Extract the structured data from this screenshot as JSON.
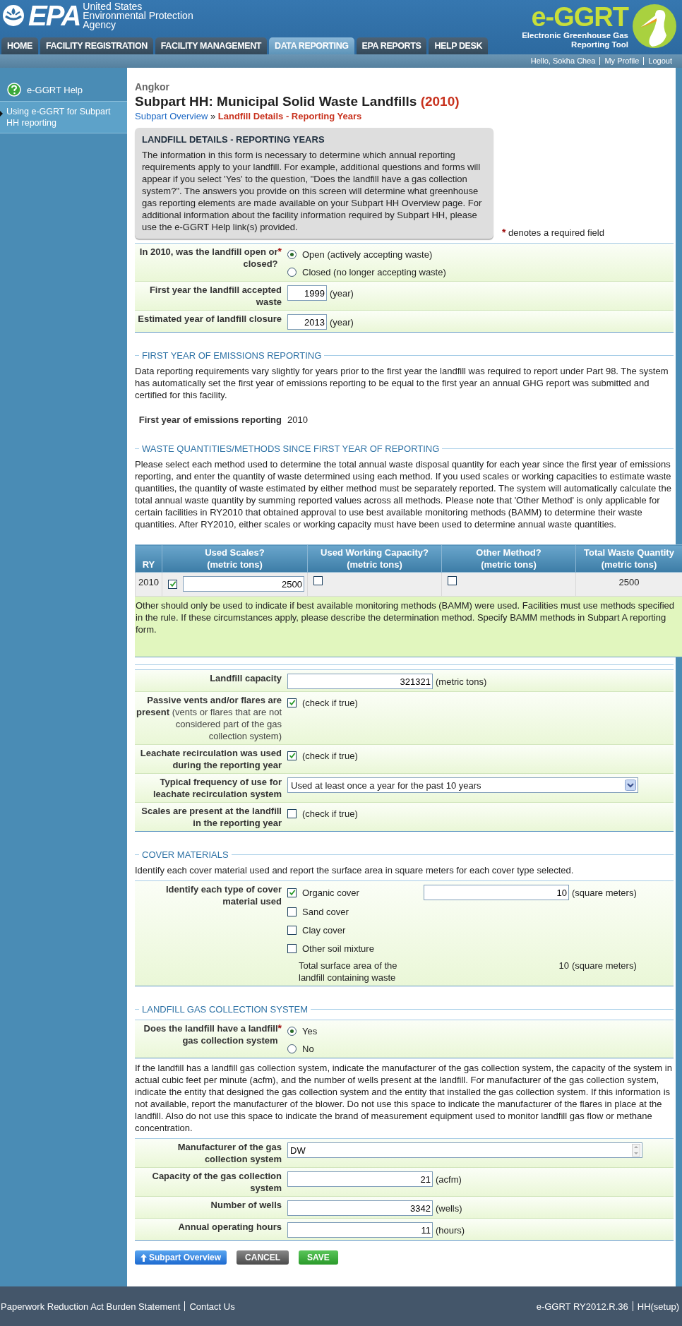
{
  "header": {
    "logo_text": "EPA",
    "agency_lines": [
      "United States",
      "Environmental Protection",
      "Agency"
    ],
    "app_logo": "e-GGRT",
    "app_subtitle_lines": [
      "Electronic Greenhouse Gas",
      "Reporting Tool"
    ]
  },
  "nav_tabs": [
    {
      "label": "HOME",
      "selected": false
    },
    {
      "label": "FACILITY REGISTRATION",
      "selected": false
    },
    {
      "label": "FACILITY MANAGEMENT",
      "selected": false
    },
    {
      "label": "DATA REPORTING",
      "selected": true
    },
    {
      "label": "EPA REPORTS",
      "selected": false
    },
    {
      "label": "HELP DESK",
      "selected": false
    }
  ],
  "user_bar": {
    "greeting": "Hello, Sokha Chea",
    "links": [
      "My Profile",
      "Logout"
    ]
  },
  "sidebar": {
    "help_title": "e-GGRT Help",
    "items": [
      {
        "label": "Using e-GGRT for Subpart HH reporting"
      }
    ]
  },
  "page": {
    "facility": "Angkor",
    "title": "Subpart HH: Municipal Solid Waste Landfills",
    "title_year": "(2010)",
    "breadcrumb": [
      {
        "label": "Subpart Overview",
        "kind": "link"
      },
      {
        "label": "Landfill Details - Reporting Years",
        "kind": "current"
      }
    ],
    "breadcrumb_separator": "»"
  },
  "info_box": {
    "title": "LANDFILL DETAILS - REPORTING YEARS",
    "text": "The information in this form is necessary to determine which annual reporting requirements apply to your landfill. For example, additional questions and forms will appear if you select 'Yes' to the question, \"Does the landfill have a gas collection system?\". The answers you provide on this screen will determine what greenhouse gas reporting elements are made available on your Subpart HH Overview page. For additional information about the facility information required by Subpart HH, please use the e-GGRT Help link(s) provided."
  },
  "required_note": {
    "mark": "*",
    "text": "denotes a required field"
  },
  "sections": [
    {
      "blocks": [
        {
          "kind": "form",
          "rows": [
            {
              "kind": "radio",
              "label": "In 2010, was the landfill open or closed?",
              "required_mark": "*",
              "options": [
                {
                  "label": "Open (actively accepting waste)",
                  "selected": true
                },
                {
                  "label": "Closed (no longer accepting waste)",
                  "selected": false
                }
              ]
            },
            {
              "kind": "year_input",
              "label": "First year the landfill accepted waste",
              "value": "1999",
              "unit": "(year)"
            },
            {
              "kind": "year_input",
              "label": "Estimated year of landfill closure",
              "value": "2013",
              "unit": "(year)"
            }
          ]
        }
      ]
    },
    {
      "heading": "FIRST YEAR OF EMISSIONS REPORTING",
      "blocks": [
        {
          "kind": "paragraph",
          "text": "Data reporting requirements vary slightly for years prior to the first year the landfill was required to report under Part 98. The system has automatically set the first year of emissions reporting to be equal to the first year an annual GHG report was submitted and certified for this facility."
        },
        {
          "kind": "facts",
          "rows": [
            {
              "label": "First year of emissions reporting",
              "value": "2010"
            }
          ]
        }
      ]
    },
    {
      "heading": "WASTE QUANTITIES/METHODS SINCE FIRST YEAR OF REPORTING",
      "blocks": [
        {
          "kind": "paragraph",
          "text": "Please select each method used to determine the total annual waste disposal quantity for each year since the first year of emissions reporting, and enter the quantity of waste determined using each method. If you used scales or working capacities to estimate waste quantities, the quantity of waste estimated by either method must be separately reported. The system will automatically calculate the total annual waste quantity by summing reported values across all methods. Please note that 'Other Method' is only applicable for certain facilities in RY2010 that obtained approval to use best available monitoring methods (BAMM) to determine their waste quantities. After RY2010, either scales or working capacity must have been used to determine annual waste quantities."
        },
        {
          "kind": "table",
          "columns": [
            {
              "title": "RY"
            },
            {
              "title": "Used Scales?",
              "unit": "(metric tons)"
            },
            {
              "title": "Used Working Capacity?",
              "unit": "(metric tons)"
            },
            {
              "title": "Other Method?",
              "unit": "(metric tons)"
            },
            {
              "title": "Total Waste Quantity",
              "unit": "(metric tons)"
            }
          ],
          "rows": [
            {
              "cells": [
                {
                  "kind": "text",
                  "value": "2010"
                },
                {
                  "kind": "check_input",
                  "checked": true,
                  "value": "2500"
                },
                {
                  "kind": "check",
                  "checked": false
                },
                {
                  "kind": "check",
                  "checked": false
                },
                {
                  "kind": "total",
                  "value": "2500"
                }
              ]
            }
          ]
        },
        {
          "kind": "note",
          "text": "Other should only be used to indicate if best available monitoring methods (BAMM) were used. Facilities must use methods specified in the rule. If these circumstances apply, please describe the determination method. Specify BAMM methods in Subpart A reporting form."
        }
      ]
    },
    {
      "blocks": [
        {
          "kind": "form",
          "rows": [
            {
              "kind": "number_input",
              "label": "Landfill capacity",
              "value": "321321",
              "unit": "(metric tons)"
            },
            {
              "kind": "checkbox",
              "label": "Passive vents and/or flares are present",
              "label_note": "(vents or flares that are not considered part of the gas collection system)",
              "checked": true,
              "caption": "(check if true)"
            },
            {
              "kind": "checkbox",
              "label": "Leachate recirculation was used during the reporting year",
              "checked": true,
              "caption": "(check if true)"
            },
            {
              "kind": "select",
              "label": "Typical frequency of use for leachate recirculation system",
              "value": "Used at least once a year for the past 10 years"
            },
            {
              "kind": "checkbox",
              "label": "Scales are present at the landfill in the reporting year",
              "checked": false,
              "caption": "(check if true)"
            }
          ]
        }
      ]
    },
    {
      "heading": "COVER MATERIALS",
      "blocks": [
        {
          "kind": "paragraph",
          "text": "Identify each cover material used and report the surface area in square meters for each cover type selected."
        },
        {
          "kind": "form",
          "rows": [
            {
              "kind": "cover",
              "label": "Identify each type of cover material used",
              "options": [
                {
                  "label": "Organic cover",
                  "checked": true,
                  "value": "10",
                  "unit": "(square meters)"
                },
                {
                  "label": "Sand cover",
                  "checked": false
                },
                {
                  "label": "Clay cover",
                  "checked": false
                },
                {
                  "label": "Other soil mixture",
                  "checked": false
                }
              ],
              "total_label": "Total surface area of the landfill containing waste",
              "total_value": "10",
              "total_unit": "(square meters)"
            }
          ]
        }
      ]
    },
    {
      "heading": "LANDFILL GAS COLLECTION SYSTEM",
      "blocks": [
        {
          "kind": "form",
          "rows": [
            {
              "kind": "radio",
              "label": "Does the landfill have a landfill gas collection system",
              "required_mark": "*",
              "options": [
                {
                  "label": "Yes",
                  "selected": true
                },
                {
                  "label": "No",
                  "selected": false
                }
              ]
            }
          ]
        },
        {
          "kind": "paragraph",
          "text": "If the landfill has a landfill gas collection system, indicate the manufacturer of the gas collection system, the capacity of the system in actual cubic feet per minute (acfm), and the number of wells present at the landfill. For manufacturer of the gas collection system, indicate the entity that designed the gas collection system and the entity that installed the gas collection system. If this information is not available, report the manufacturer of the blower. Do not use this space to indicate the manufacturer of the flares in place at the landfill. Also do not use this space to indicate the brand of measurement equipment used to monitor landfill gas flow or methane concentration."
        },
        {
          "kind": "form",
          "rows": [
            {
              "kind": "text_input",
              "label": "Manufacturer of the gas collection system",
              "value": "DW"
            },
            {
              "kind": "number_input",
              "label": "Capacity of the gas collection system",
              "value": "21",
              "unit": "(acfm)"
            },
            {
              "kind": "number_input",
              "label": "Number of wells",
              "value": "3342",
              "unit": "(wells)"
            },
            {
              "kind": "number_input",
              "label": "Annual operating hours",
              "value": "11",
              "unit": "(hours)"
            }
          ]
        }
      ]
    }
  ],
  "buttons": [
    {
      "label": "Subpart Overview",
      "kind": "back"
    },
    {
      "label": "CANCEL",
      "kind": "cancel"
    },
    {
      "label": "SAVE",
      "kind": "save"
    }
  ],
  "footer": {
    "left_links": [
      "Paperwork Reduction Act Burden Statement",
      "Contact Us"
    ],
    "right_items": [
      "e-GGRT RY2012.R.36",
      "HH(setup)"
    ]
  }
}
